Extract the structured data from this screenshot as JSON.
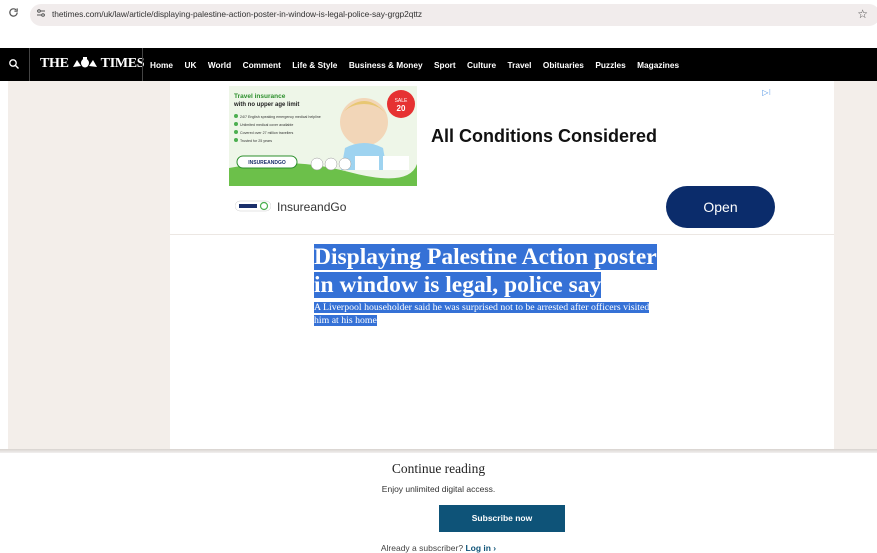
{
  "browser": {
    "url": "thetimes.com/uk/law/article/displaying-palestine-action-poster-in-window-is-legal-police-say-grgp2qttz"
  },
  "site": {
    "logo_left": "THE",
    "logo_right": "TIMES",
    "menu": [
      "Home",
      "UK",
      "World",
      "Comment",
      "Life & Style",
      "Business & Money",
      "Sport",
      "Culture",
      "Travel",
      "Obituaries",
      "Puzzles",
      "Magazines"
    ]
  },
  "ad": {
    "img_title": "Travel insurance",
    "img_sub": "with no upper age limit",
    "img_bullets": [
      "24/7 English speaking emergency medical helpline",
      "Unlimited medical cover available",
      "Covered over 27 million travellers",
      "Trusted for 25 years"
    ],
    "img_badge_top": "SALE",
    "img_badge_num": "20",
    "img_logo": "INSUREANDGO",
    "headline": "All Conditions Considered",
    "brand": "InsureandGo",
    "cta": "Open"
  },
  "article": {
    "headline_line1": "Displaying Palestine Action poster",
    "headline_line2": "in window is legal, police say",
    "standfirst_line1": "A Liverpool householder said he was surprised not to be arrested after officers visited",
    "standfirst_line2": "him at his home"
  },
  "paywall": {
    "title": "Continue reading",
    "subtitle": "Enjoy unlimited digital access.",
    "button": "Subscribe now",
    "login_prefix": "Already a subscriber?",
    "login_link": "Log in ›"
  }
}
